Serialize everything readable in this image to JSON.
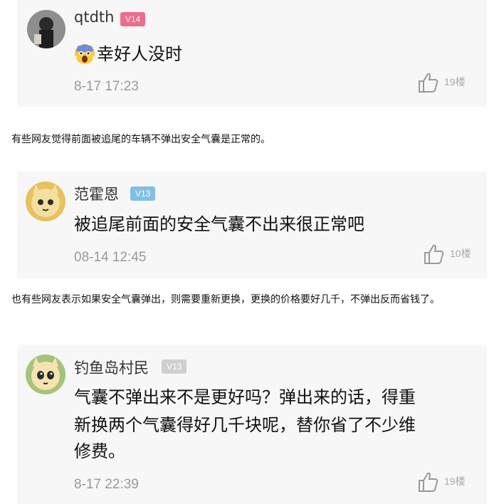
{
  "comments": [
    {
      "username": "qtdth",
      "level": "V14",
      "level_color": "#f06a8c",
      "emoji": "fearful-face-icon",
      "text": "幸好人没时",
      "time": "8-17 17:23",
      "floor": "19楼"
    },
    {
      "username": "范霍恩",
      "level": "V13",
      "level_color": "#7fbfe8",
      "text": "被追尾前面的安全气囊不出来很正常吧",
      "time": "08-14 12:45",
      "floor": "10楼"
    },
    {
      "username": "钓鱼岛村民",
      "level": "V13",
      "level_color": "#cfcfcf",
      "text_line1": "气囊不弹出来不是更好吗？弹出来的话，得重",
      "text_line2": "新换两个气囊得好几千块呢，替你省了不少维",
      "text_line3": "修费。",
      "time": "8-17 22:39",
      "floor": "19楼"
    }
  ],
  "narration": [
    "有些网友觉得前面被追尾的车辆不弹出安全气囊是正常的。",
    "也有些网友表示如果安全气囊弹出，则需要重新更换，更换的价格要好几千，不弹出反而省钱了。"
  ]
}
